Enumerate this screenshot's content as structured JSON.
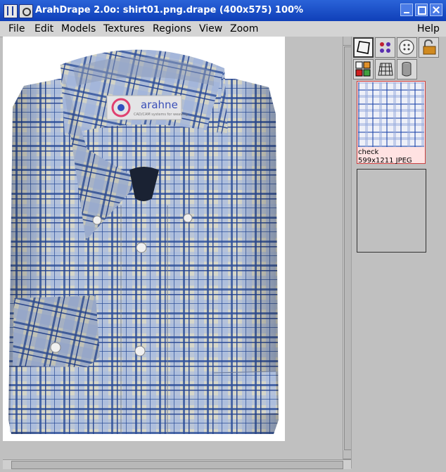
{
  "window": {
    "title": "ArahDrape 2.0o: shirt01.png.drape (400x575) 100%",
    "icons": [
      "arahdrape-app-icon",
      "window-menu-icon",
      "minimize-icon",
      "maximize-icon",
      "close-icon"
    ]
  },
  "menu": {
    "file": "File",
    "edit": "Edit",
    "models": "Models",
    "textures": "Textures",
    "regions": "Regions",
    "view": "View",
    "zoom": "Zoom",
    "help": "Help"
  },
  "canvas": {
    "logo_text": "arahne",
    "logo_subtext": "CAD/CAM systems for weaving"
  },
  "toolbar": {
    "tools": [
      "select-region-icon",
      "points-icon",
      "button-icon",
      "lock-icon",
      "masks-icon",
      "grid-icon",
      "cylinder-icon"
    ]
  },
  "textures": {
    "items": [
      {
        "name": "check",
        "info": "599x1211 JPEG",
        "selected": true
      },
      {
        "name": "",
        "info": "",
        "selected": false
      }
    ]
  },
  "colors": {
    "titlebar": "#1a4fcc",
    "shirt_base": "#b9c7dd",
    "check_dark": "#1f3f8f",
    "check_light": "#e6e2cf",
    "selection": "#c84040"
  }
}
